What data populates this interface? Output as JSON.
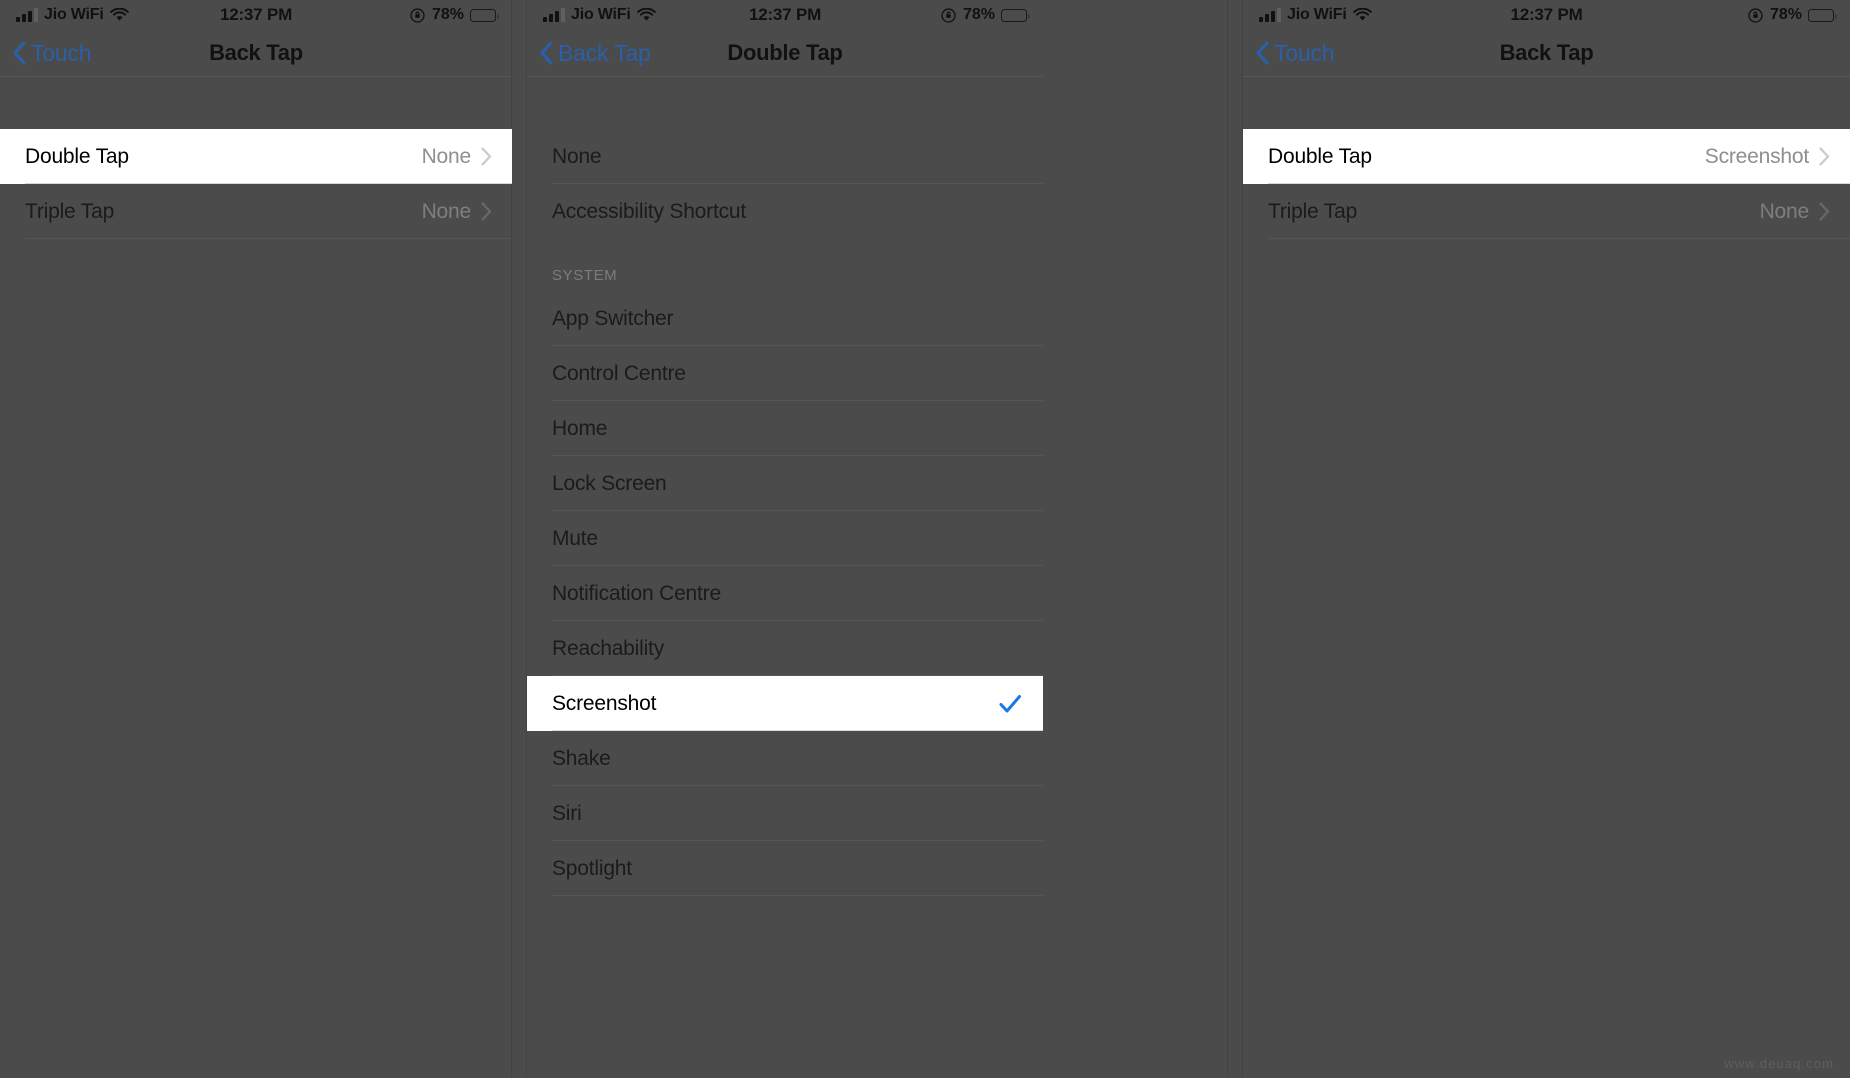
{
  "meta": {
    "watermark": "www.deuaq.com",
    "accent_blue": "#2b5fa8",
    "check_blue": "#1878e8",
    "dim_bg": "#4b4b4b",
    "highlight_bg": "#ffffff"
  },
  "status_bar": {
    "carrier": "Jio WiFi",
    "time": "12:37 PM",
    "battery_percent": "78%",
    "icons": {
      "signal": "cellular-signal-icon",
      "wifi": "wifi-icon",
      "rotation_lock": "rotation-lock-icon",
      "battery": "battery-icon"
    }
  },
  "panels": [
    {
      "id": "back-tap-before",
      "nav": {
        "back_label": "Touch",
        "title": "Back Tap"
      },
      "rows": [
        {
          "label": "Double Tap",
          "value": "None",
          "highlight": true,
          "chevron": true
        },
        {
          "label": "Triple Tap",
          "value": "None",
          "highlight": false,
          "chevron": true
        }
      ]
    },
    {
      "id": "double-tap-options",
      "nav": {
        "back_label": "Back Tap",
        "title": "Double Tap"
      },
      "section_top": [
        {
          "label": "None",
          "highlight": false,
          "checked": false
        },
        {
          "label": "Accessibility Shortcut",
          "highlight": false,
          "checked": false
        }
      ],
      "section_system_header": "SYSTEM",
      "section_system": [
        {
          "label": "App Switcher",
          "highlight": false,
          "checked": false
        },
        {
          "label": "Control Centre",
          "highlight": false,
          "checked": false
        },
        {
          "label": "Home",
          "highlight": false,
          "checked": false
        },
        {
          "label": "Lock Screen",
          "highlight": false,
          "checked": false
        },
        {
          "label": "Mute",
          "highlight": false,
          "checked": false
        },
        {
          "label": "Notification Centre",
          "highlight": false,
          "checked": false
        },
        {
          "label": "Reachability",
          "highlight": false,
          "checked": false
        },
        {
          "label": "Screenshot",
          "highlight": true,
          "checked": true
        },
        {
          "label": "Shake",
          "highlight": false,
          "checked": false
        },
        {
          "label": "Siri",
          "highlight": false,
          "checked": false
        },
        {
          "label": "Spotlight",
          "highlight": false,
          "checked": false
        }
      ]
    },
    {
      "id": "back-tap-after",
      "nav": {
        "back_label": "Touch",
        "title": "Back Tap"
      },
      "rows": [
        {
          "label": "Double Tap",
          "value": "Screenshot",
          "highlight": true,
          "chevron": true
        },
        {
          "label": "Triple Tap",
          "value": "None",
          "highlight": false,
          "chevron": true
        }
      ]
    }
  ]
}
